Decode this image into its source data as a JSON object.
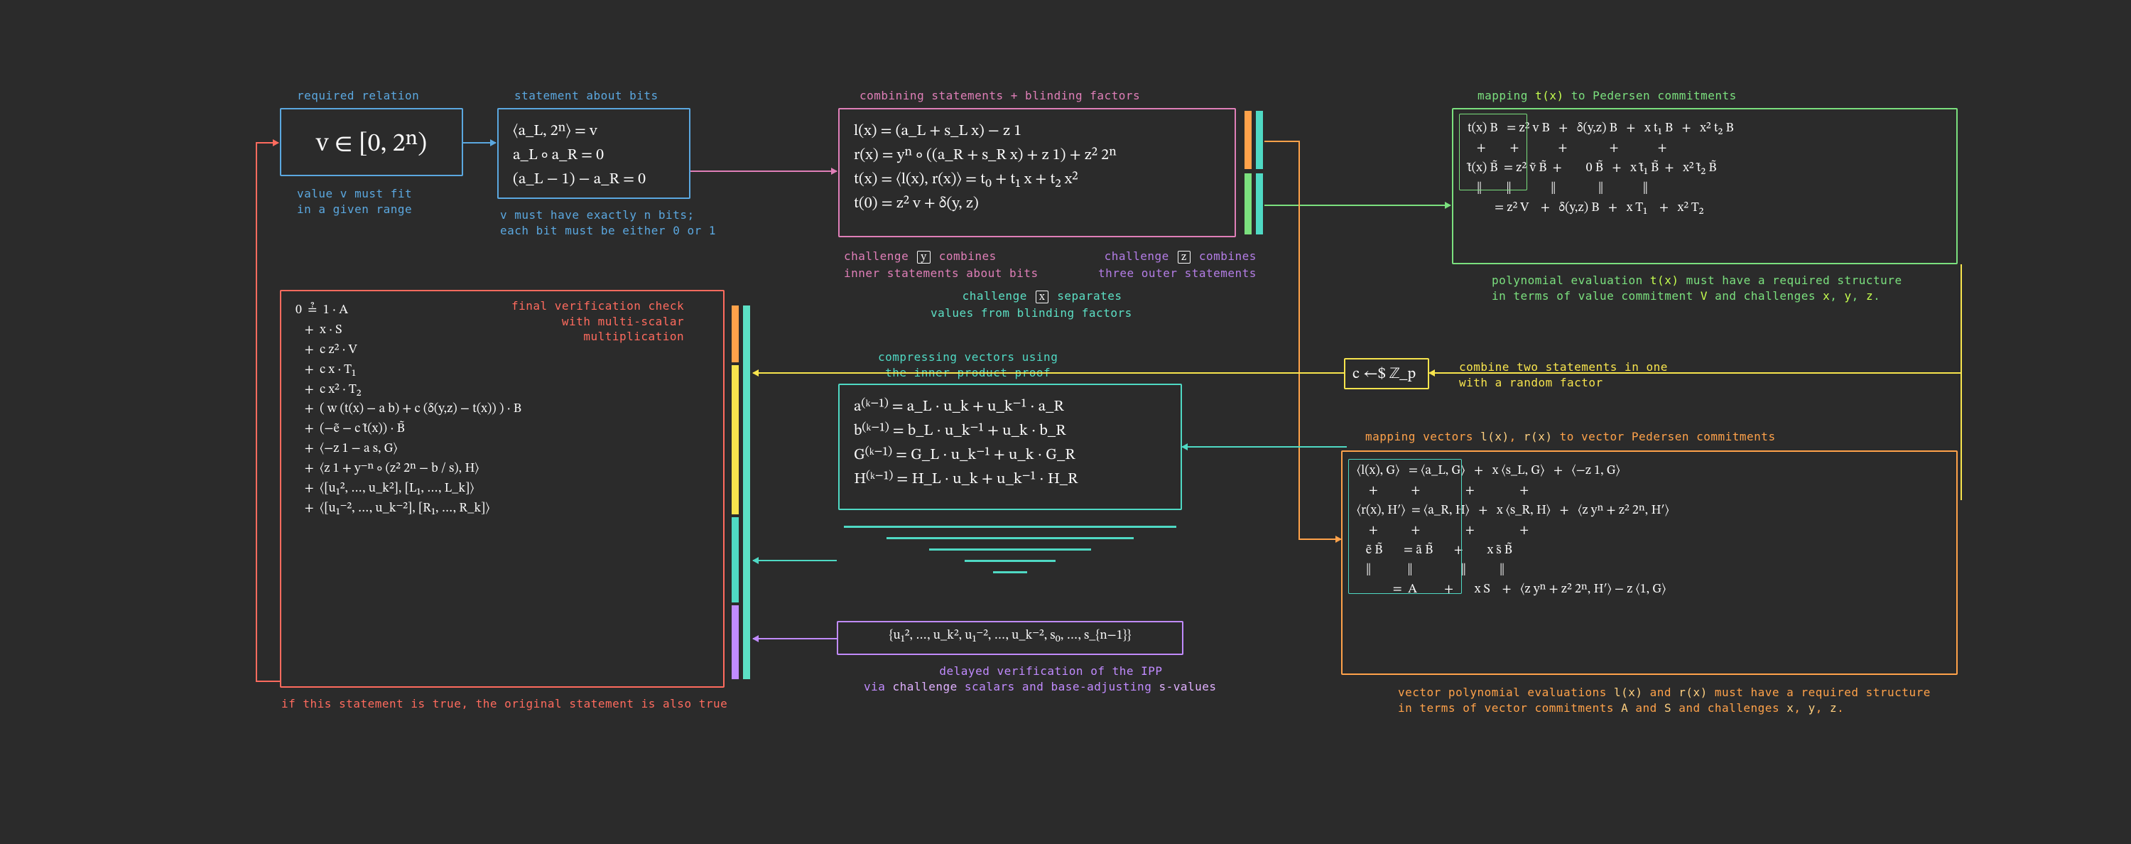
{
  "colors": {
    "blue": "#5ba8e0",
    "pink": "#e07fb8",
    "green": "#7be07e",
    "lime": "#c6ff4f",
    "orange": "#ffa24a",
    "red": "#ff6b5e",
    "teal": "#4fd9c4",
    "purple": "#c18bff",
    "yellow": "#f7e44d",
    "mint": "#5ce0c5",
    "violet": "#b47de6",
    "bg": "#2b2b2b"
  },
  "relation_box": {
    "title": "required relation",
    "formula": "v ∈ [0, 2ⁿ)",
    "caption": "value v must fit\nin a given range"
  },
  "bits_box": {
    "title": "statement about bits",
    "lines": [
      "⟨a_L, 2ⁿ⟩ = v",
      "a_L ∘ a_R = 0",
      "(a_L − 1) − a_R = 0"
    ],
    "caption": "v must have exactly n bits;\neach bit must be either 0 or 1",
    "var_v": "v"
  },
  "combine_box": {
    "title": "combining statements + blinding factors",
    "lines": [
      "l(x) = (a_L + s_L x) − z 1",
      "r(x) = yⁿ ∘ ((a_R + s_R x) + z 1) + z² 2ⁿ",
      "t(x) = ⟨l(x), r(x)⟩ = t₀ + t₁ x + t₂ x²",
      "t(0) = z² v + δ(y, z)"
    ],
    "caption_y": "challenge y combines\ninner statements about bits",
    "caption_z": "challenge z combines\nthree outer statements",
    "caption_x": "challenge x separates\nvalues from blinding factors"
  },
  "chal_y": "y",
  "chal_z": "z",
  "chal_x": "x",
  "tx_box": {
    "title_pre": "mapping ",
    "title_code": "t(x)",
    "title_post": " to Pedersen commitments",
    "rows": [
      "t(x) B   = z² v B   +   δ(y,z) B   +   x t₁ B   +   x² t₂ B",
      "   +        +             +              +             +",
      "t̃(x) B̃  = z² ṽ B̃  +        0 B̃   +   x t̃₁ B̃  +   x² t̃₂ B̃",
      "   ‖        ‖             ‖              ‖             ‖",
      "         = z² V    +   δ(y,z) B   +   x T₁    +   x² T₂"
    ],
    "caption": "polynomial evaluation t(x) must have a required structure\nin terms of value commitment V and challenges x, y, z."
  },
  "tx_vars": {
    "tx": "t(x)",
    "V": "V",
    "x": "x",
    "y": "y",
    "z": "z"
  },
  "c_box": {
    "formula": "c ←$ ℤ_p",
    "caption": "combine two statements in one\nwith a random factor"
  },
  "vec_box": {
    "title_pre": "mapping vectors ",
    "title_lx": "l(x)",
    "title_sep": ", ",
    "title_rx": "r(x)",
    "title_post": " to vector Pedersen commitments",
    "inner_rows": [
      "⟨l(x), G⟩   = ⟨a_L, G⟩   +   x ⟨s_L, G⟩   +   ⟨−z 1, G⟩",
      "    +           +               +               +",
      "⟨r(x), H′⟩  = ⟨a_R, H⟩   +   x ⟨s_R, H⟩   +   ⟨z yⁿ + z² 2ⁿ, H′⟩",
      "    +           +               +               +",
      "   ẽ B̃       = ã B̃       +        x s̃ B̃"
    ],
    "outer_rows": [
      "   ‖            ‖                ‖           ‖",
      "            =  A         +       x S    +   ⟨z yⁿ + z² 2ⁿ, H′⟩ − z ⟨1, G⟩"
    ],
    "caption": "vector polynomial evaluations l(x) and r(x) must have a required structure\nin terms of vector commitments A and S and challenges x, y, z."
  },
  "vec_vars": {
    "lx": "l(x)",
    "rx": "r(x)",
    "A": "A",
    "S": "S"
  },
  "ipp_box": {
    "title": "compressing vectors using\nthe inner product proof",
    "lines": [
      "a⁽ᵏ⁻¹⁾ = a_L · u_k + u_k⁻¹ · a_R",
      "b⁽ᵏ⁻¹⁾ = b_L · u_k⁻¹ + u_k · b_R",
      "G⁽ᵏ⁻¹⁾ = G_L · u_k⁻¹ + u_k · G_R",
      "H⁽ᵏ⁻¹⁾ = H_L · u_k + u_k⁻¹ · H_R"
    ],
    "s_values": "{u₁², …, u_k², u₁⁻², …, u_k⁻², s₀, …, s_{n−1}}",
    "caption": "delayed verification of the IPP\nvia challenge scalars and base-adjusting s-values",
    "challenge_word": "challenge",
    "svalues_word": "s-values"
  },
  "final_box": {
    "title": "final verification check\nwith multi-scalar\nmultiplication",
    "lines": [
      "0  ≟  1 · A",
      "   +  x · S",
      "   +  c z² · V",
      "   +  c x · T₁",
      "   +  c x² · T₂",
      "   +  ( w (t(x) − a b) + c (δ(y,z) − t(x)) ) · B",
      "   +  (−ẽ − c t̃(x)) · B̃",
      "   +  ⟨−z 1 − a s, G⟩",
      "   +  ⟨z 1 + y⁻ⁿ ∘ (z² 2ⁿ − b / s), H⟩",
      "   +  ⟨[u₁², …, u_k²], [L₁, …, L_k]⟩",
      "   +  ⟨[u₁⁻², …, u_k⁻²], [R₁, …, R_k]⟩"
    ],
    "caption": "if this statement is true, the original statement is also true"
  }
}
